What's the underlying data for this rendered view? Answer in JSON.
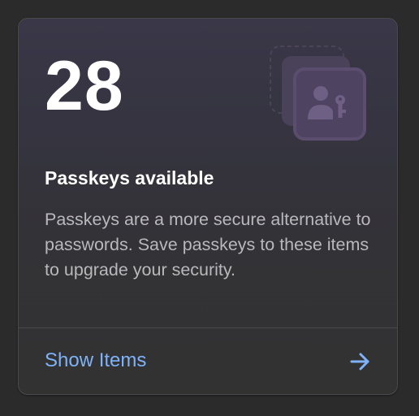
{
  "card": {
    "count": "28",
    "title": "Passkeys available",
    "description": "Passkeys are a more secure alternative to passwords. Save passkeys to these items to upgrade your security.",
    "action_label": "Show Items",
    "illustration_icon": "passkey-icon",
    "action_icon": "arrow-right-icon"
  },
  "colors": {
    "background": "#2b2b2b",
    "card_top": "#3a3748",
    "card_bottom": "#323232",
    "link": "#7fb2f7",
    "illustration": "#5a4d6e"
  }
}
